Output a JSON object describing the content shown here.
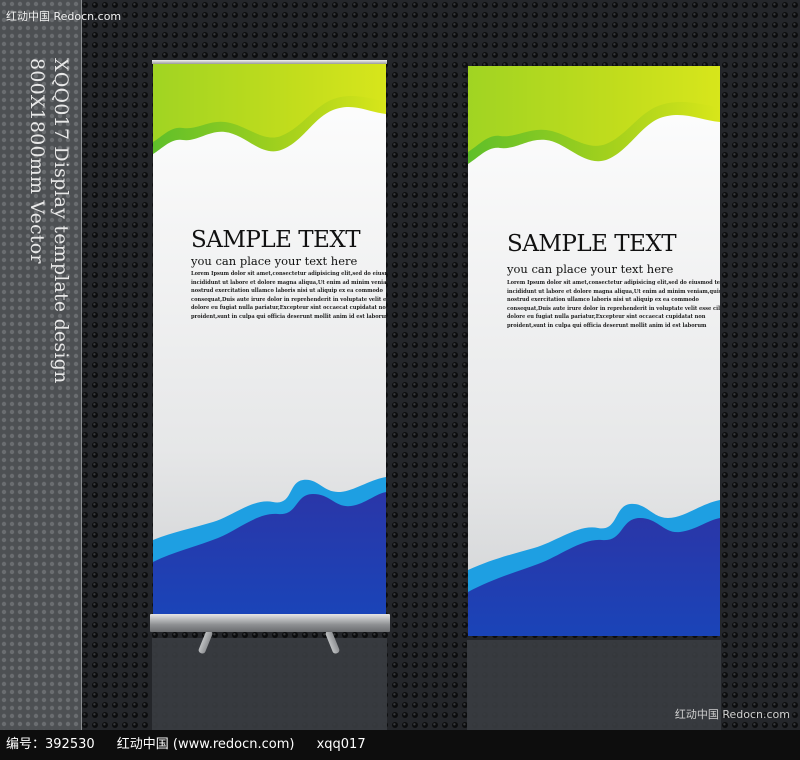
{
  "watermark_top": "红动中国 Redocn.com",
  "watermark_bottom_right": "红动中国 Redocn.com",
  "side_text": {
    "line1": "XQQ017 Display template design",
    "line2": "800X1800mm Vector"
  },
  "banner_left": {
    "title": "SAMPLE TEXT",
    "subtitle": "you can place your text here",
    "body": "Lorem Ipsum dolor sit amet,consectetur adipisicing elit,sed do eiusmod tempor\nincididunt ut labore et dolore magna aliqua,Ut enim ad minim veniam,quis\nnostrud exercitation ullamco laboris nisi ut aliquip ex ea commodo\nconsequat,Duis aute irure dolor in reprehenderit in voluptate velit esse cillum\ndolore eu fugiat nulla pariatur,Excepteur sint occaecat cupidatat non\nproident,sunt in culpa qui officia deserunt mollit anim id est laborum"
  },
  "banner_right": {
    "title": "SAMPLE TEXT",
    "subtitle": "you can place your text here",
    "body": "Lorem Ipsum dolor sit amet,consectetur adipisicing elit,sed do eiusmod tempor\nincididunt ut labore et dolore magna aliqua,Ut enim ad minim veniam,quis\nnostrud exercitation ullamco laboris nisi ut aliquip ex ea commodo\nconsequat,Duis aute irure dolor in reprehenderit in voluptate velit esse cillum\ndolore eu fugiat nulla pariatur,Excepteur sint occaecat cupidatat non\nproident,sunt in culpa qui officia deserunt mollit anim id est laborum"
  },
  "footer": {
    "code_label": "编号：392530",
    "site": "红动中国 (www.redocn.com)",
    "author": "xqq017"
  },
  "colors": {
    "green": "#9ccf1f",
    "lime": "#d3e61a",
    "blue": "#1f3fa6",
    "cyan": "#1c9be0",
    "background": "#1b1c1f"
  }
}
